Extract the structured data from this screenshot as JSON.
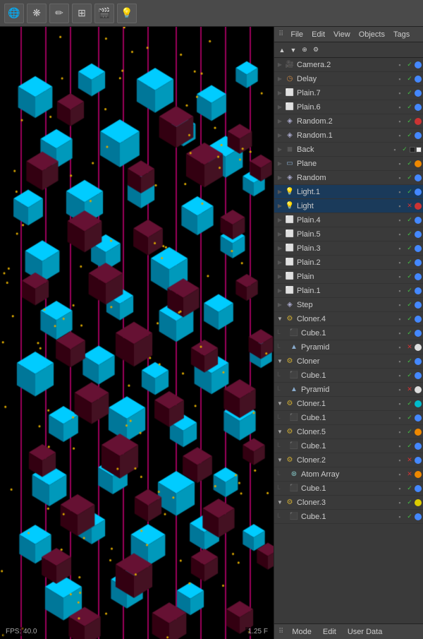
{
  "toolbar": {
    "tools": [
      {
        "name": "world-icon",
        "symbol": "🌐"
      },
      {
        "name": "scatter-icon",
        "symbol": "❋"
      },
      {
        "name": "pen-icon",
        "symbol": "✏"
      },
      {
        "name": "grid-icon",
        "symbol": "⊞"
      },
      {
        "name": "camera-tool-icon",
        "symbol": "🎬"
      },
      {
        "name": "light-tool-icon",
        "symbol": "💡"
      }
    ]
  },
  "viewport": {
    "fps_label": "FPS: 40.0",
    "zoom_label": "1.25 F"
  },
  "object_manager": {
    "menu_items": [
      "File",
      "Edit",
      "View",
      "Objects",
      "Tags"
    ],
    "toolbar_buttons": [
      "move-up",
      "move-down",
      "new-object",
      "settings"
    ],
    "objects": [
      {
        "id": "camera2",
        "name": "Camera.2",
        "indent": 0,
        "expand": false,
        "icon": "camera",
        "visible": true,
        "locked": true,
        "dot_color": "blue"
      },
      {
        "id": "delay",
        "name": "Delay",
        "indent": 0,
        "expand": false,
        "icon": "delay",
        "visible": true,
        "locked": true,
        "dot_color": "blue"
      },
      {
        "id": "plain7",
        "name": "Plain.7",
        "indent": 0,
        "expand": false,
        "icon": "plain",
        "visible": true,
        "locked": true,
        "dot_color": "blue"
      },
      {
        "id": "plain6",
        "name": "Plain.6",
        "indent": 0,
        "expand": false,
        "icon": "plain",
        "visible": true,
        "locked": true,
        "dot_color": "blue"
      },
      {
        "id": "random2",
        "name": "Random.2",
        "indent": 0,
        "expand": false,
        "icon": "random",
        "visible": true,
        "locked": false,
        "dot_color": "red"
      },
      {
        "id": "random1",
        "name": "Random.1",
        "indent": 0,
        "expand": false,
        "icon": "random",
        "visible": true,
        "locked": true,
        "dot_color": "blue"
      },
      {
        "id": "back",
        "name": "Back",
        "indent": 0,
        "expand": false,
        "icon": "back",
        "visible": true,
        "locked": true,
        "dot_color": "black",
        "extra": "checkered"
      },
      {
        "id": "plane",
        "name": "Plane",
        "indent": 0,
        "expand": false,
        "icon": "plane",
        "visible": true,
        "locked": false,
        "dot_color": "orange"
      },
      {
        "id": "random",
        "name": "Random",
        "indent": 0,
        "expand": false,
        "icon": "random",
        "visible": true,
        "locked": true,
        "dot_color": "blue"
      },
      {
        "id": "light1",
        "name": "Light.1",
        "indent": 0,
        "expand": false,
        "icon": "light",
        "visible": true,
        "locked": true,
        "dot_color": "blue"
      },
      {
        "id": "light",
        "name": "Light",
        "indent": 0,
        "expand": false,
        "icon": "light",
        "visible": false,
        "locked": false,
        "dot_color": "red"
      },
      {
        "id": "plain4",
        "name": "Plain.4",
        "indent": 0,
        "expand": false,
        "icon": "plain",
        "visible": true,
        "locked": false,
        "dot_color": "blue"
      },
      {
        "id": "plain5",
        "name": "Plain.5",
        "indent": 0,
        "expand": false,
        "icon": "plain",
        "visible": true,
        "locked": true,
        "dot_color": "blue"
      },
      {
        "id": "plain3",
        "name": "Plain.3",
        "indent": 0,
        "expand": false,
        "icon": "plain",
        "visible": true,
        "locked": true,
        "dot_color": "blue"
      },
      {
        "id": "plain2",
        "name": "Plain.2",
        "indent": 0,
        "expand": false,
        "icon": "plain",
        "visible": true,
        "locked": true,
        "dot_color": "blue"
      },
      {
        "id": "plain",
        "name": "Plain",
        "indent": 0,
        "expand": false,
        "icon": "plain",
        "visible": true,
        "locked": true,
        "dot_color": "blue"
      },
      {
        "id": "plain1",
        "name": "Plain.1",
        "indent": 0,
        "expand": false,
        "icon": "plain",
        "visible": true,
        "locked": true,
        "dot_color": "blue"
      },
      {
        "id": "step",
        "name": "Step",
        "indent": 0,
        "expand": false,
        "icon": "step",
        "visible": true,
        "locked": true,
        "dot_color": "blue"
      },
      {
        "id": "cloner4",
        "name": "Cloner.4",
        "indent": 0,
        "expand": true,
        "icon": "cloner",
        "visible": true,
        "locked": true,
        "dot_color": "blue"
      },
      {
        "id": "cube1a",
        "name": "Cube.1",
        "indent": 1,
        "expand": false,
        "icon": "cube",
        "visible": true,
        "locked": true,
        "dot_color": "blue"
      },
      {
        "id": "pyramid1a",
        "name": "Pyramid",
        "indent": 1,
        "expand": false,
        "icon": "pyramid",
        "visible": false,
        "locked": false,
        "dot_color": "white"
      },
      {
        "id": "cloner",
        "name": "Cloner",
        "indent": 0,
        "expand": true,
        "icon": "cloner",
        "visible": true,
        "locked": true,
        "dot_color": "blue"
      },
      {
        "id": "cube1b",
        "name": "Cube.1",
        "indent": 1,
        "expand": false,
        "icon": "cube",
        "visible": true,
        "locked": true,
        "dot_color": "blue"
      },
      {
        "id": "pyramid1b",
        "name": "Pyramid",
        "indent": 1,
        "expand": false,
        "icon": "pyramid",
        "visible": false,
        "locked": false,
        "dot_color": "white"
      },
      {
        "id": "cloner1",
        "name": "Cloner.1",
        "indent": 0,
        "expand": true,
        "icon": "cloner",
        "visible": true,
        "locked": true,
        "dot_color": "cyan"
      },
      {
        "id": "cube1c",
        "name": "Cube.1",
        "indent": 1,
        "expand": false,
        "icon": "cube",
        "visible": true,
        "locked": true,
        "dot_color": "blue"
      },
      {
        "id": "cloner5",
        "name": "Cloner.5",
        "indent": 0,
        "expand": true,
        "icon": "cloner",
        "visible": true,
        "locked": true,
        "dot_color": "orange"
      },
      {
        "id": "cube1d",
        "name": "Cube.1",
        "indent": 1,
        "expand": false,
        "icon": "cube",
        "visible": true,
        "locked": true,
        "dot_color": "blue"
      },
      {
        "id": "cloner2",
        "name": "Cloner.2",
        "indent": 0,
        "expand": true,
        "icon": "cloner",
        "visible": false,
        "locked": false,
        "dot_color": "blue"
      },
      {
        "id": "atomarray",
        "name": "Atom Array",
        "indent": 1,
        "expand": false,
        "icon": "atom",
        "visible": false,
        "locked": false,
        "dot_color": "orange"
      },
      {
        "id": "cube1e",
        "name": "Cube.1",
        "indent": 1,
        "expand": false,
        "icon": "cube",
        "visible": true,
        "locked": true,
        "dot_color": "blue"
      },
      {
        "id": "cloner3",
        "name": "Cloner.3",
        "indent": 0,
        "expand": true,
        "icon": "cloner",
        "visible": true,
        "locked": true,
        "dot_color": "yellow"
      },
      {
        "id": "cube1f",
        "name": "Cube.1",
        "indent": 1,
        "expand": false,
        "icon": "cube",
        "visible": true,
        "locked": true,
        "dot_color": "blue"
      }
    ]
  },
  "bottom_bar": {
    "tabs": [
      "Mode",
      "Edit",
      "User Data"
    ]
  },
  "colors": {
    "bg_dark": "#1a1a1a",
    "bg_mid": "#3a3a3a",
    "bg_light": "#4a4a4a",
    "accent_blue": "#4488ff",
    "accent_orange": "#ff8800"
  }
}
